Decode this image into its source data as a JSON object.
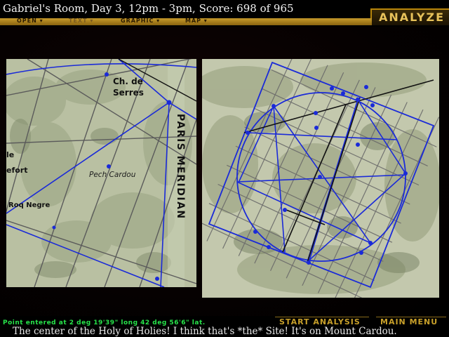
{
  "title_bar": {
    "text": "Gabriel's Room, Day 3, 12pm - 3pm, Score: 698 of 965"
  },
  "mode_tab": {
    "label": "ANALYZE"
  },
  "menu": {
    "items": [
      {
        "label": "OPEN ▾",
        "enabled": true
      },
      {
        "label": "TEXT ▾",
        "enabled": false
      },
      {
        "label": "GRAPHIC ▾",
        "enabled": true
      },
      {
        "label": "MAP ▾",
        "enabled": true
      }
    ]
  },
  "left_map": {
    "labels": {
      "ch_de_serres": "Ch. de\nSerres",
      "paris_meridian": "PARIS MERIDIAN",
      "pech_cardou": "Pech Cardou",
      "roq_negre": "Roq Negre",
      "le": "le",
      "efort": "efort"
    }
  },
  "status": {
    "point_entered": "Point entered at 2 deg 19'39\" long  42 deg 56'6\" lat."
  },
  "buttons": {
    "start_analysis": "START ANALYSIS",
    "main_menu": "MAIN MENU"
  },
  "narration": {
    "text": "The center of the Holy of Holies!  I think that's *the* Site!  It's on Mount Cardou."
  },
  "colors": {
    "overlay_blue": "#1a2ad8",
    "menu_gold": "#c69a2a",
    "status_green": "#27e34a",
    "map_bg": "#b7bfa2"
  }
}
